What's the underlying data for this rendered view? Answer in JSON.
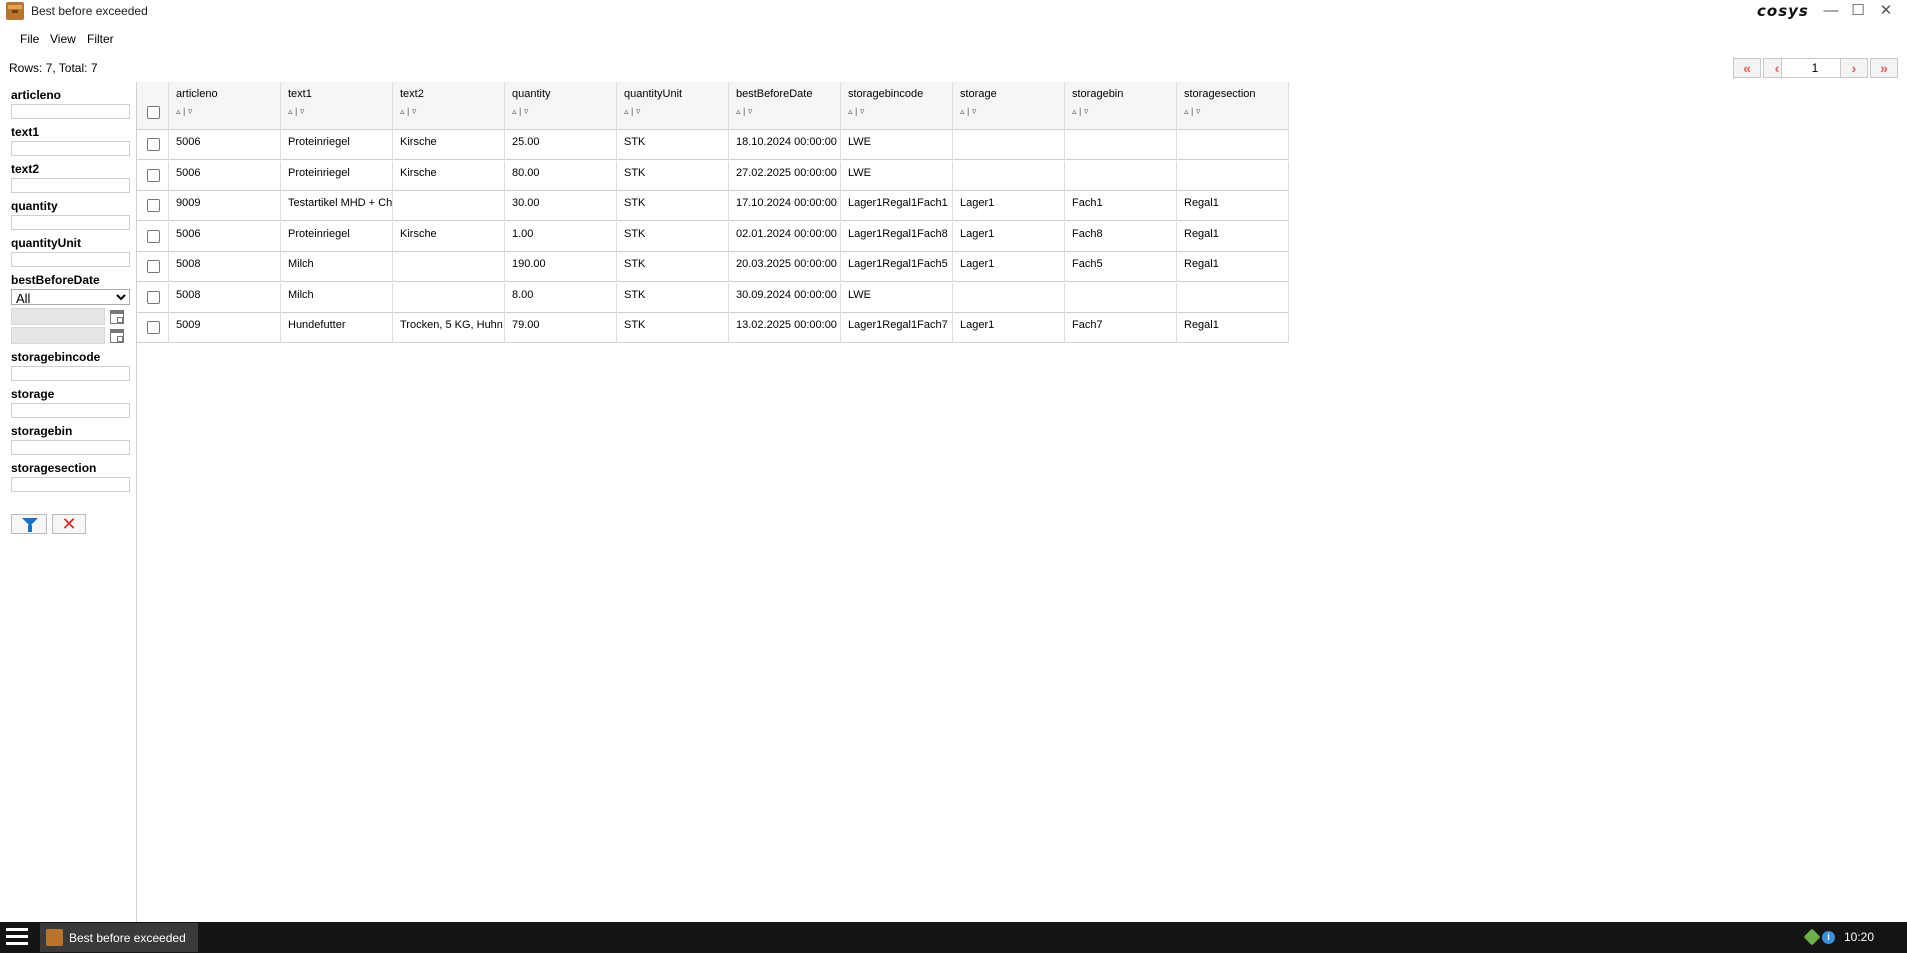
{
  "window": {
    "title": "Best before exceeded",
    "logo": "cosys",
    "controls": {
      "minimize": "—",
      "maximize": "☐",
      "close": "✕"
    }
  },
  "menu": {
    "file": "File",
    "view": "View",
    "filter": "Filter"
  },
  "toolbar": {
    "rows_info": "Rows: 7, Total: 7",
    "pager": {
      "first": "«",
      "prev": "‹",
      "page": "1",
      "next": "›",
      "last": "»"
    }
  },
  "filters": {
    "articleno": "articleno",
    "text1": "text1",
    "text2": "text2",
    "quantity": "quantity",
    "quantityUnit": "quantityUnit",
    "bestBeforeDate": "bestBeforeDate",
    "bestBeforeDate_option": "All",
    "storagebincode": "storagebincode",
    "storage": "storage",
    "storagebin": "storagebin",
    "storagesection": "storagesection"
  },
  "table": {
    "columns": [
      "articleno",
      "text1",
      "text2",
      "quantity",
      "quantityUnit",
      "bestBeforeDate",
      "storagebincode",
      "storage",
      "storagebin",
      "storagesection"
    ],
    "sort_glyph": "▵ | ▿",
    "rows": [
      [
        "5006",
        "Proteinriegel",
        "Kirsche",
        "25.00",
        "STK",
        "18.10.2024 00:00:00",
        "LWE",
        "",
        "",
        ""
      ],
      [
        "5006",
        "Proteinriegel",
        "Kirsche",
        "80.00",
        "STK",
        "27.02.2025 00:00:00",
        "LWE",
        "",
        "",
        ""
      ],
      [
        "9009",
        "Testartikel MHD + Ch",
        "",
        "30.00",
        "STK",
        "17.10.2024 00:00:00",
        "Lager1Regal1Fach1",
        "Lager1",
        "Fach1",
        "Regal1"
      ],
      [
        "5006",
        "Proteinriegel",
        "Kirsche",
        "1.00",
        "STK",
        "02.01.2024 00:00:00",
        "Lager1Regal1Fach8",
        "Lager1",
        "Fach8",
        "Regal1"
      ],
      [
        "5008",
        "Milch",
        "",
        "190.00",
        "STK",
        "20.03.2025 00:00:00",
        "Lager1Regal1Fach5",
        "Lager1",
        "Fach5",
        "Regal1"
      ],
      [
        "5008",
        "Milch",
        "",
        "8.00",
        "STK",
        "30.09.2024 00:00:00",
        "LWE",
        "",
        "",
        ""
      ],
      [
        "5009",
        "Hundefutter",
        "Trocken, 5 KG, Huhn",
        "79.00",
        "STK",
        "13.02.2025 00:00:00",
        "Lager1Regal1Fach7",
        "Lager1",
        "Fach7",
        "Regal1"
      ]
    ]
  },
  "taskbar": {
    "task_label": "Best before exceeded",
    "clock": "10:20",
    "tray_info": "i"
  }
}
